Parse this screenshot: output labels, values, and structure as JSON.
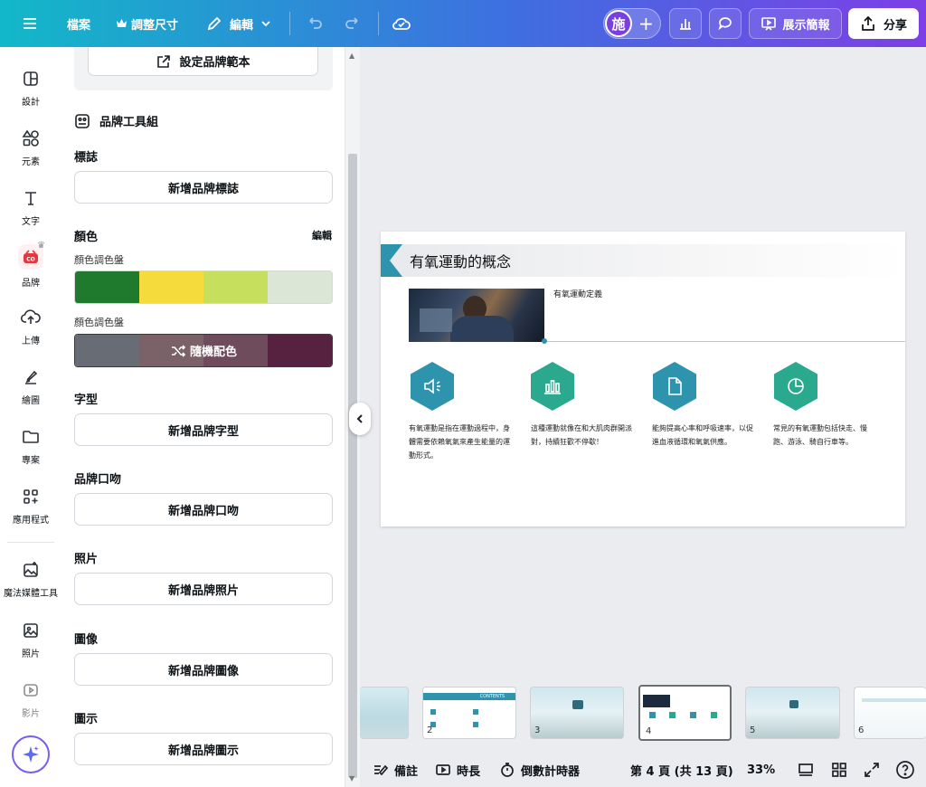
{
  "topbar": {
    "menu_icon": "hamburger-icon",
    "file_label": "檔案",
    "resize_label": "調整尺寸",
    "edit_label": "編輯",
    "avatar_initial": "施",
    "present_label": "展示簡報",
    "share_label": "分享"
  },
  "rail": {
    "items": [
      {
        "label": "設計",
        "icon": "layout-icon"
      },
      {
        "label": "元素",
        "icon": "shapes-icon"
      },
      {
        "label": "文字",
        "icon": "text-icon"
      },
      {
        "label": "品牌",
        "icon": "brand-icon"
      },
      {
        "label": "上傳",
        "icon": "upload-cloud-icon"
      },
      {
        "label": "繪圖",
        "icon": "draw-icon"
      },
      {
        "label": "專案",
        "icon": "folder-icon"
      },
      {
        "label": "應用程式",
        "icon": "apps-icon"
      },
      {
        "label": "魔法媒體工具",
        "icon": "magic-media-icon"
      },
      {
        "label": "照片",
        "icon": "photo-icon"
      },
      {
        "label": "影片",
        "icon": "video-icon"
      }
    ]
  },
  "panel": {
    "set_template_label": "設定品牌範本",
    "brand_kit_title": "品牌工具組",
    "logo_heading": "標誌",
    "add_logo_label": "新增品牌標誌",
    "color_heading": "顏色",
    "color_edit_label": "編輯",
    "palette1_label": "顏色調色盤",
    "palette1_colors": [
      "#1f7a2e",
      "#f5dc3c",
      "#c6e05e",
      "#dbe6d6"
    ],
    "palette2_label": "顏色調色盤",
    "palette2_colors": [
      "#686d75",
      "#7a6268",
      "#6e4c5c",
      "#56223f"
    ],
    "shuffle_label": "隨機配色",
    "font_heading": "字型",
    "add_font_label": "新增品牌字型",
    "voice_heading": "品牌口吻",
    "add_voice_label": "新增品牌口吻",
    "photo_heading": "照片",
    "add_photo_label": "新增品牌照片",
    "graphic_heading": "圖像",
    "add_graphic_label": "新增品牌圖像",
    "icon_heading": "圖示",
    "add_icon_label": "新增品牌圖示"
  },
  "slide": {
    "title": "有氧運動的概念",
    "definition_label": "有氧運動定義",
    "accent": "#2e94ad",
    "points": [
      {
        "icon": "speaker-icon",
        "color": "#2e94ad",
        "text": "有氧運動是指在運動過程中，身體需要依賴氧氣來產生能量的運動形式。"
      },
      {
        "icon": "bar-chart-icon",
        "color": "#2aa98e",
        "text": "這種運動就像在和大肌肉群開派對，持續狂歡不停歇！"
      },
      {
        "icon": "document-icon",
        "color": "#2e94ad",
        "text": "能夠提高心率和呼吸速率，以促進血液循環和氧氣供應。"
      },
      {
        "icon": "pie-chart-icon",
        "color": "#2aa98e",
        "text": "常見的有氧運動包括快走、慢跑、游泳、騎自行車等。"
      }
    ]
  },
  "thumbnails": [
    {
      "number": ""
    },
    {
      "number": "2",
      "title": "CONTENTS"
    },
    {
      "number": "3"
    },
    {
      "number": "4"
    },
    {
      "number": "5"
    },
    {
      "number": "6"
    }
  ],
  "bottombar": {
    "notes_label": "備註",
    "duration_label": "時長",
    "timer_label": "倒數計時器",
    "page_indicator": "第 4 頁 (共 13 頁)",
    "zoom": "33%"
  }
}
